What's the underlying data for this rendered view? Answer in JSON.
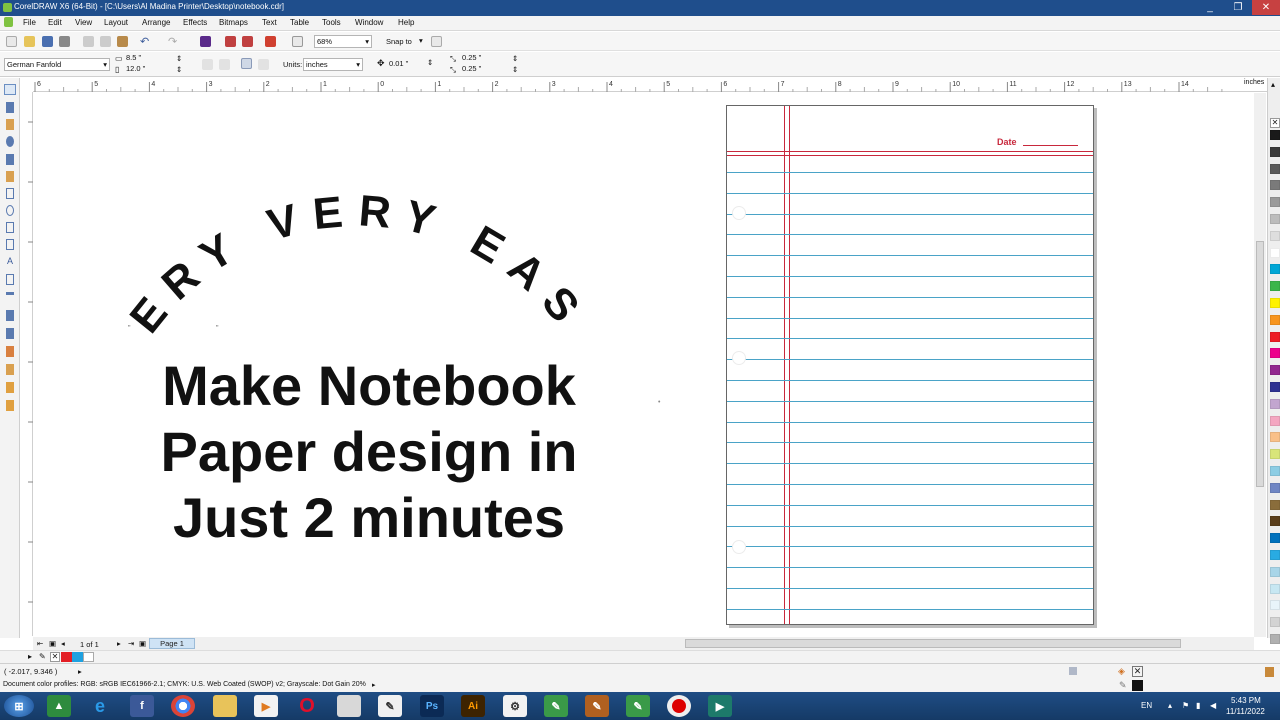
{
  "window": {
    "title": "CorelDRAW X6 (64-Bit) - [C:\\Users\\Al Madina Printer\\Desktop\\notebook.cdr]",
    "controls": [
      "_",
      "❐",
      "✕"
    ]
  },
  "menu": [
    "File",
    "Edit",
    "View",
    "Layout",
    "Arrange",
    "Effects",
    "Bitmaps",
    "Text",
    "Table",
    "Tools",
    "Window",
    "Help"
  ],
  "toolbar": {
    "zoom": "68%",
    "snap_to": "Snap to"
  },
  "property_bar": {
    "page_size": "German Fanfold",
    "width": "8.5 \"",
    "height": "12.0 \"",
    "units_label": "Units:",
    "units": "inches",
    "nudge": "0.01 \"",
    "dup_x": "0.25 \"",
    "dup_y": "0.25 \""
  },
  "ruler": {
    "unit": "inches",
    "labels": [
      "6",
      "5",
      "4",
      "3",
      "2",
      "1",
      "0",
      "1",
      "2",
      "3",
      "4",
      "5",
      "6",
      "7",
      "8",
      "9",
      "10",
      "11",
      "12",
      "13",
      "14"
    ]
  },
  "artwork": {
    "arc_text": "VERY VERY EASY",
    "headline": [
      "Make Notebook",
      "Paper design in",
      "Just 2 minutes"
    ]
  },
  "notebook": {
    "date_label": "Date",
    "colors": {
      "margin": "#c8283c",
      "rule": "#4aa3c7"
    }
  },
  "page_nav": {
    "counter": "1 of 1",
    "tab": "Page 1"
  },
  "status": {
    "coords": "( -2.017, 9.346 )",
    "profiles": "Document color profiles: RGB: sRGB IEC61966-2.1; CMYK: U.S. Web Coated (SWOP) v2; Grayscale: Dot Gain 20%"
  },
  "palette": [
    "#1a1a1a",
    "#3a3a3a",
    "#5a5a5a",
    "#7a7a7a",
    "#9a9a9a",
    "#bcbcbc",
    "#dedede",
    "#ffffff",
    "#00a6d6",
    "#3bb54a",
    "#fff200",
    "#f7941d",
    "#ed1c24",
    "#ec008c",
    "#92278f",
    "#2e3192",
    "#c2a5cf",
    "#f4a6c1",
    "#f9c089",
    "#d8e57a",
    "#8ccde4",
    "#6f86c4",
    "#8a6d3b",
    "#5a3e1b",
    "#0071bc",
    "#29abe2",
    "#a8d5e8",
    "#c7e7f2",
    "#e8f4fa",
    "#d3d3d3",
    "#b0b0b0"
  ],
  "taskbar": {
    "lang": "EN",
    "time": "5:43 PM",
    "date": "11/11/2022"
  }
}
